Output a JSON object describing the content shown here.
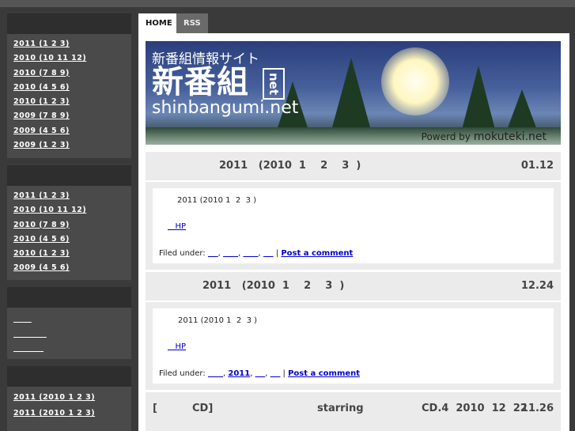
{
  "sidebar": {
    "box1": [
      "2011 (1 2 3)",
      "2010 (10 11 12)",
      "2010 (7 8 9)",
      "2010 (4 5 6)",
      "2010 (1 2 3)",
      "2009 (7 8 9)",
      "2009 (4 5 6)",
      "2009 (1 2 3)"
    ],
    "box2": [
      "2011 (1 2 3)",
      "2010 (10 11 12)",
      "2010 (7 8 9)",
      "2010 (4 5 6)",
      "2010 (1 2 3)",
      "2009 (4 5 6)"
    ],
    "box3": [
      "      ",
      "           ",
      "          "
    ],
    "box4": [
      "              2011 (2010 1  2 3)",
      "         2011 (2010 1 2  3)"
    ]
  },
  "tabs": {
    "home": "HOME",
    "rss": "RSS"
  },
  "banner": {
    "subtitle": "新番組情報サイト",
    "big": "新番組",
    "net": "net",
    "url": "shinbangumi.net",
    "powered": "Powerd by",
    "powered_brand": "mokuteki.net"
  },
  "posts": [
    {
      "title": "2011   (2010  1    2    3  )",
      "date": "01.12",
      "text": "2011 (2010 1  2  3 )",
      "hp": "   HP",
      "filed_label": "Filed under: ",
      "tags": [
        "    ",
        "      ",
        "      ",
        "    "
      ],
      "comment": "Post a comment"
    },
    {
      "title": "2011   (2010  1    2    3  )",
      "date": "12.24",
      "text": "2011 (2010 1  2  3 )",
      "hp": "   HP",
      "filed_label": "Filed under: ",
      "tags": [
        "      ",
        "2011",
        "    ",
        "    "
      ],
      "comment": "Post a comment"
    }
  ],
  "post3": {
    "bracket": "[",
    "cd": "CD]",
    "starring": "starring",
    "info": "CD.4  2010  12  22",
    "date": "11.26"
  }
}
